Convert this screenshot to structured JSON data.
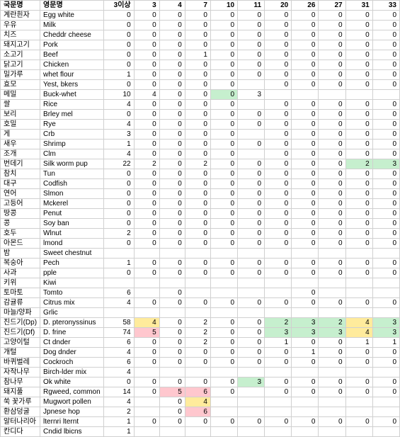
{
  "headers": {
    "kr": "국문명",
    "en": "영문명",
    "cols": [
      "3이상",
      "3",
      "4",
      "7",
      "10",
      "11",
      "20",
      "26",
      "27",
      "31",
      "33"
    ]
  },
  "rows": [
    {
      "kr": "계란흰자",
      "en": "Egg white",
      "v": [
        "0",
        "0",
        "0",
        "0",
        "0",
        "0",
        "0",
        "0",
        "0",
        "0",
        "0"
      ]
    },
    {
      "kr": "우유",
      "en": "Milk",
      "v": [
        "0",
        "0",
        "0",
        "0",
        "0",
        "0",
        "0",
        "0",
        "0",
        "0",
        "0"
      ]
    },
    {
      "kr": "치즈",
      "en": "Cheddr cheese",
      "v": [
        "0",
        "0",
        "0",
        "0",
        "0",
        "0",
        "0",
        "0",
        "0",
        "0",
        "0"
      ]
    },
    {
      "kr": "돼지고기",
      "en": "Pork",
      "v": [
        "0",
        "0",
        "0",
        "0",
        "0",
        "0",
        "0",
        "0",
        "0",
        "0",
        "0"
      ]
    },
    {
      "kr": "소고기",
      "en": "Beef",
      "v": [
        "0",
        "0",
        "0",
        "1",
        "0",
        "0",
        "0",
        "0",
        "0",
        "0",
        "0"
      ]
    },
    {
      "kr": "닭고기",
      "en": "Chicken",
      "v": [
        "0",
        "0",
        "0",
        "0",
        "0",
        "0",
        "0",
        "0",
        "0",
        "0",
        "0"
      ]
    },
    {
      "kr": "밀가루",
      "en": "whet flour",
      "v": [
        "1",
        "0",
        "0",
        "0",
        "0",
        "0",
        "0",
        "0",
        "0",
        "0",
        "0"
      ]
    },
    {
      "kr": "효모",
      "en": "Yest, bkers",
      "v": [
        "0",
        "0",
        "0",
        "0",
        "0",
        "",
        "0",
        "0",
        "0",
        "0",
        "0"
      ]
    },
    {
      "kr": "메밀",
      "en": "Buck-whet",
      "v": [
        "10",
        "4",
        "0",
        "0",
        "0",
        "3",
        "",
        "",
        "",
        "",
        ""
      ],
      "colors": {
        "5": "green"
      }
    },
    {
      "kr": "쌀",
      "en": "Rice",
      "v": [
        "4",
        "0",
        "0",
        "0",
        "0",
        "",
        "0",
        "0",
        "0",
        "0",
        "0"
      ]
    },
    {
      "kr": "보리",
      "en": "Brley mel",
      "v": [
        "0",
        "0",
        "0",
        "0",
        "0",
        "0",
        "0",
        "0",
        "0",
        "0",
        "0"
      ]
    },
    {
      "kr": "호밀",
      "en": "Rye",
      "v": [
        "4",
        "0",
        "0",
        "0",
        "0",
        "0",
        "0",
        "0",
        "0",
        "0",
        "0"
      ]
    },
    {
      "kr": "게",
      "en": "Crb",
      "v": [
        "3",
        "0",
        "0",
        "0",
        "0",
        "",
        "0",
        "0",
        "0",
        "0",
        "0"
      ]
    },
    {
      "kr": "새우",
      "en": "Shrimp",
      "v": [
        "1",
        "0",
        "0",
        "0",
        "0",
        "0",
        "0",
        "0",
        "0",
        "0",
        "0"
      ]
    },
    {
      "kr": "조개",
      "en": "Clm",
      "v": [
        "4",
        "0",
        "0",
        "0",
        "0",
        "",
        "0",
        "0",
        "0",
        "0",
        "0"
      ]
    },
    {
      "kr": "번데기",
      "en": "Silk worm pup",
      "v": [
        "22",
        "2",
        "0",
        "2",
        "0",
        "0",
        "0",
        "0",
        "0",
        "2",
        "3"
      ],
      "colors": {
        "10": "green",
        "11": "green"
      }
    },
    {
      "kr": "참치",
      "en": "Tun",
      "v": [
        "0",
        "0",
        "0",
        "0",
        "0",
        "0",
        "0",
        "0",
        "0",
        "0",
        "0"
      ]
    },
    {
      "kr": "대구",
      "en": "Codfish",
      "v": [
        "0",
        "0",
        "0",
        "0",
        "0",
        "0",
        "0",
        "0",
        "0",
        "0",
        "0"
      ]
    },
    {
      "kr": "연어",
      "en": "Slmon",
      "v": [
        "0",
        "0",
        "0",
        "0",
        "0",
        "0",
        "0",
        "0",
        "0",
        "0",
        "0"
      ]
    },
    {
      "kr": "고등어",
      "en": "Mckerel",
      "v": [
        "0",
        "0",
        "0",
        "0",
        "0",
        "0",
        "0",
        "0",
        "0",
        "0",
        "0"
      ]
    },
    {
      "kr": "땅콩",
      "en": "Penut",
      "v": [
        "0",
        "0",
        "0",
        "0",
        "0",
        "0",
        "0",
        "0",
        "0",
        "0",
        "0"
      ]
    },
    {
      "kr": "콩",
      "en": "Soy ban",
      "v": [
        "0",
        "0",
        "0",
        "0",
        "0",
        "0",
        "0",
        "0",
        "0",
        "0",
        "0"
      ]
    },
    {
      "kr": "호두",
      "en": "Wlnut",
      "v": [
        "2",
        "0",
        "0",
        "0",
        "0",
        "0",
        "0",
        "0",
        "0",
        "0",
        "0"
      ]
    },
    {
      "kr": "아몬드",
      "en": "lmond",
      "v": [
        "0",
        "0",
        "0",
        "0",
        "0",
        "0",
        "0",
        "0",
        "0",
        "0",
        "0"
      ]
    },
    {
      "kr": "밤",
      "en": "Sweet chestnut",
      "v": [
        "",
        "",
        "",
        "",
        "",
        "",
        "",
        "",
        "",
        "",
        ""
      ]
    },
    {
      "kr": "복숭아",
      "en": "Pech",
      "v": [
        "1",
        "0",
        "0",
        "0",
        "0",
        "0",
        "0",
        "0",
        "0",
        "0",
        "0"
      ]
    },
    {
      "kr": "사과",
      "en": "pple",
      "v": [
        "0",
        "0",
        "0",
        "0",
        "0",
        "0",
        "0",
        "0",
        "0",
        "0",
        "0"
      ]
    },
    {
      "kr": "키위",
      "en": "Kiwi",
      "v": [
        "",
        "",
        "",
        "",
        "",
        "",
        "",
        "",
        "",
        "",
        ""
      ]
    },
    {
      "kr": "토마토",
      "en": "Tomto",
      "v": [
        "6",
        "",
        "0",
        "",
        "",
        "",
        "",
        "0",
        "",
        "",
        ""
      ]
    },
    {
      "kr": "감귤류",
      "en": "Citrus mix",
      "v": [
        "4",
        "0",
        "0",
        "0",
        "0",
        "0",
        "0",
        "0",
        "0",
        "0",
        "0"
      ]
    },
    {
      "kr": "마늘/양파",
      "en": "Grlic",
      "v": [
        "",
        "",
        "",
        "",
        "",
        "",
        "",
        "",
        "",
        "",
        ""
      ]
    },
    {
      "kr": "진드기(Dp)",
      "en": "D. pteronyssinus",
      "v": [
        "58",
        "4",
        "0",
        "2",
        "0",
        "0",
        "2",
        "3",
        "2",
        "4",
        "3"
      ],
      "colors": {
        "2": "yellow",
        "7": "green",
        "8": "green",
        "9": "green",
        "10": "yellow",
        "11": "green"
      }
    },
    {
      "kr": "진드기(Df)",
      "en": "D. frine",
      "v": [
        "74",
        "5",
        "0",
        "2",
        "0",
        "0",
        "3",
        "3",
        "3",
        "4",
        "3"
      ],
      "colors": {
        "2": "pink",
        "7": "green",
        "8": "green",
        "9": "green",
        "10": "yellow",
        "11": "green"
      }
    },
    {
      "kr": "고양이털",
      "en": "Ct dnder",
      "v": [
        "6",
        "0",
        "0",
        "2",
        "0",
        "0",
        "1",
        "0",
        "0",
        "1",
        "1"
      ]
    },
    {
      "kr": "개털",
      "en": "Dog dnder",
      "v": [
        "4",
        "0",
        "0",
        "0",
        "0",
        "0",
        "0",
        "1",
        "0",
        "0",
        "0"
      ]
    },
    {
      "kr": "바퀴벌레",
      "en": "Cockroch",
      "v": [
        "6",
        "0",
        "0",
        "0",
        "0",
        "0",
        "0",
        "0",
        "0",
        "0",
        "0"
      ]
    },
    {
      "kr": "자작나무",
      "en": "Birch-lder mix",
      "v": [
        "4",
        "",
        "",
        "",
        "",
        "",
        "",
        "",
        "",
        "",
        ""
      ]
    },
    {
      "kr": "참나무",
      "en": "Ok white",
      "v": [
        "0",
        "0",
        "0",
        "0",
        "0",
        "3",
        "0",
        "0",
        "0",
        "0",
        "0"
      ],
      "colors": {
        "6": "green"
      }
    },
    {
      "kr": "돼지풀",
      "en": "Rgweed, common",
      "v": [
        "14",
        "0",
        "5",
        "6",
        "0",
        "",
        "0",
        "0",
        "0",
        "0",
        "0"
      ],
      "colors": {
        "3": "pink",
        "4": "pink"
      }
    },
    {
      "kr": "쑥 꽃가루",
      "en": "Mugwort pollen",
      "v": [
        "4",
        "",
        "0",
        "4",
        "",
        "",
        "",
        "",
        "",
        "",
        ""
      ],
      "colors": {
        "4": "yellow"
      }
    },
    {
      "kr": "환삼덩굴",
      "en": "Jpnese hop",
      "v": [
        "2",
        "",
        "0",
        "6",
        "",
        "",
        "",
        "",
        "",
        "",
        ""
      ],
      "colors": {
        "4": "pink"
      }
    },
    {
      "kr": "알터나리아",
      "en": "lternri lternt",
      "v": [
        "1",
        "0",
        "0",
        "0",
        "0",
        "0",
        "0",
        "0",
        "0",
        "0",
        "0"
      ]
    },
    {
      "kr": "칸디다",
      "en": "Cndid lbicns",
      "v": [
        "1",
        "",
        "",
        "",
        "",
        "",
        "",
        "",
        "",
        "",
        ""
      ]
    }
  ]
}
